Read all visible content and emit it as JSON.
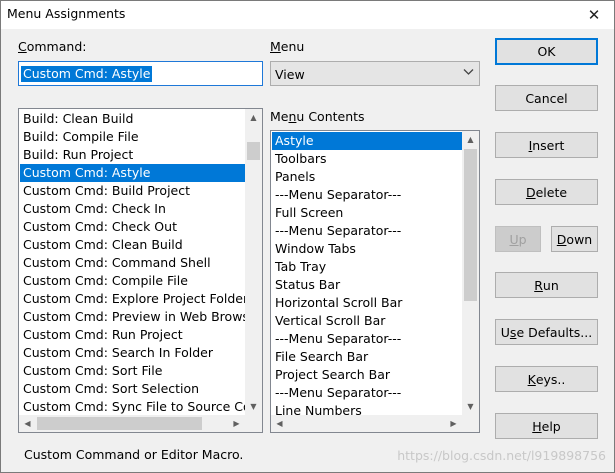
{
  "window": {
    "title": "Menu Assignments",
    "close_glyph": "✕"
  },
  "command": {
    "label_accel": "C",
    "label_rest": "ommand:",
    "value": "Custom Cmd: Astyle",
    "list": [
      "Build: Clean Build",
      "Build: Compile File",
      "Build: Run Project",
      "Custom Cmd: Astyle",
      "Custom Cmd: Build Project",
      "Custom Cmd: Check In",
      "Custom Cmd: Check Out",
      "Custom Cmd: Clean Build",
      "Custom Cmd: Command Shell",
      "Custom Cmd: Compile File",
      "Custom Cmd: Explore Project Folder",
      "Custom Cmd: Preview in Web Browser",
      "Custom Cmd: Run Project",
      "Custom Cmd: Search In Folder",
      "Custom Cmd: Sort File",
      "Custom Cmd: Sort Selection",
      "Custom Cmd: Sync File to Source Control"
    ],
    "selected_index": 3
  },
  "menu": {
    "label_accel": "M",
    "label_rest": "enu",
    "selected": "View",
    "dropdown_icon": "chevron-down-icon"
  },
  "menu_contents": {
    "label_pre": "Me",
    "label_accel": "n",
    "label_rest": "u Contents",
    "items": [
      "Astyle",
      "Toolbars",
      "Panels",
      "---Menu Separator---",
      "Full Screen",
      "---Menu Separator---",
      "Window Tabs",
      "Tab Tray",
      "Status Bar",
      "Horizontal Scroll Bar",
      "Vertical Scroll Bar",
      "---Menu Separator---",
      "File Search Bar",
      "Project Search Bar",
      "---Menu Separator---",
      "Line Numbers"
    ],
    "selected_index": 0
  },
  "buttons": {
    "ok": "OK",
    "cancel": "Cancel",
    "insert_accel": "I",
    "insert_rest": "nsert",
    "delete_accel": "D",
    "delete_rest": "elete",
    "up_accel": "U",
    "up_rest": "p",
    "down_accel": "D",
    "down_rest": "own",
    "run_accel": "R",
    "run_rest": "un",
    "use_defaults_pre": "U",
    "use_defaults_accel": "s",
    "use_defaults_rest": "e Defaults...",
    "keys_accel": "K",
    "keys_rest": "eys..",
    "help_accel": "H",
    "help_rest": "elp"
  },
  "status_text": "Custom Command or Editor Macro.",
  "watermark": "https://blog.csdn.net/l919898756",
  "colors": {
    "selection": "#0078d7",
    "dialog_bg": "#f0f0f0",
    "default_button_border": "#0078d7"
  }
}
